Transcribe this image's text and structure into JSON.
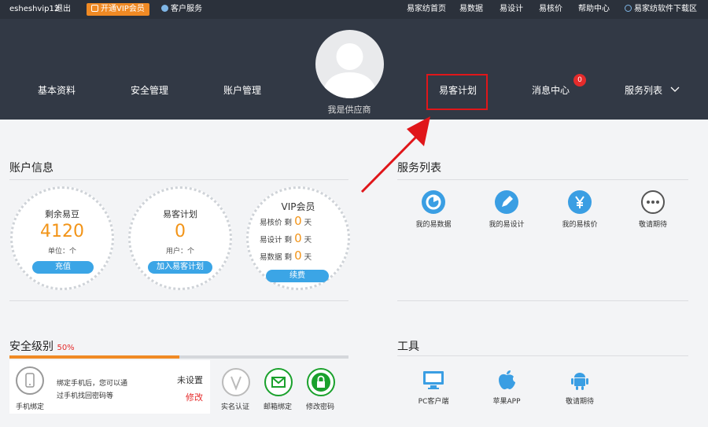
{
  "topbar": {
    "username": "esheshvip12",
    "logout": "退出",
    "vip_button": "开通VIP会员",
    "customer_service": "客户服务",
    "links": [
      "易家纺首页",
      "易数据",
      "易设计",
      "易核价",
      "帮助中心"
    ],
    "download": "易家纺软件下载区"
  },
  "header": {
    "nav_left": [
      "基本资料",
      "安全管理",
      "账户管理"
    ],
    "avatar_name": "我是供应商",
    "nav_right": [
      "易客计划",
      "消息中心",
      "服务列表"
    ],
    "message_count": "0"
  },
  "account": {
    "title": "账户信息",
    "beans": {
      "label": "剩余易豆",
      "value": "4120",
      "unit": "单位：个",
      "button": "充值"
    },
    "plan": {
      "label": "易客计划",
      "value": "0",
      "unit": "用户：个",
      "button": "加入易客计划"
    },
    "vip": {
      "label": "VIP会员",
      "rows": [
        {
          "name": "易核价 剩",
          "num": "0",
          "suffix": "天"
        },
        {
          "name": "易设计 剩",
          "num": "0",
          "suffix": "天"
        },
        {
          "name": "易数据 剩",
          "num": "0",
          "suffix": "天"
        }
      ],
      "button": "续费"
    }
  },
  "services": {
    "title": "服务列表",
    "items": [
      {
        "label": "我的易数据",
        "icon": "data-icon"
      },
      {
        "label": "我的易设计",
        "icon": "pencil-icon"
      },
      {
        "label": "我的易核价",
        "icon": "yen-icon"
      },
      {
        "label": "敬请期待",
        "icon": "more-icon"
      }
    ]
  },
  "security": {
    "title": "安全级别",
    "level": "50%",
    "progress": 0.5,
    "phone_label": "手机绑定",
    "phone_desc1": "绑定手机后，您可以通",
    "phone_desc2": "过手机找回密码等",
    "status": "未设置",
    "action": "修改",
    "items": [
      "实名认证",
      "邮箱绑定",
      "修改密码"
    ]
  },
  "tools": {
    "title": "工具",
    "items": [
      {
        "label": "PC客户端",
        "icon": "monitor-icon"
      },
      {
        "label": "苹果APP",
        "icon": "apple-icon"
      },
      {
        "label": "敬请期待",
        "icon": "android-icon"
      }
    ]
  },
  "colors": {
    "accent": "#3ba5e6",
    "orange": "#f08a24",
    "green": "#1aa12c",
    "highlight": "#e0161a"
  }
}
